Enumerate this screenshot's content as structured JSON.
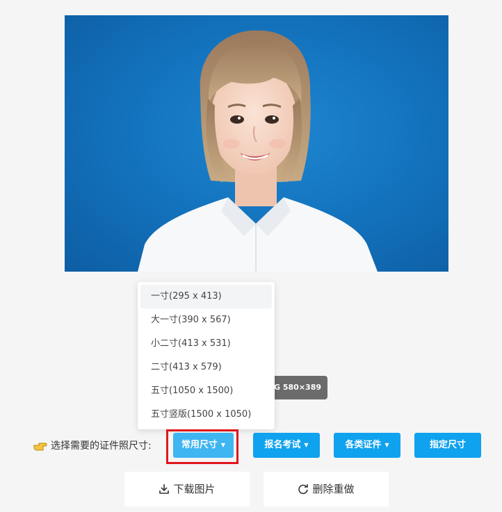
{
  "photo": {
    "alt": "ID photo portrait on blue background",
    "background_color": "#1474bf"
  },
  "image_info": "PG 580×389",
  "dropdown": {
    "items": [
      {
        "label": "一寸(295 x 413)",
        "active": true
      },
      {
        "label": "大一寸(390 x 567)"
      },
      {
        "label": "小二寸(413 x 531)"
      },
      {
        "label": "二寸(413 x 579)"
      },
      {
        "label": "五寸(1050 x 1500)"
      },
      {
        "label": "五寸竖版(1500 x 1050)"
      }
    ]
  },
  "size_row": {
    "label": "选择需要的证件照尺寸:",
    "buttons": {
      "common": "常用尺寸",
      "exam": "报名考试",
      "certs": "各类证件",
      "custom": "指定尺寸"
    }
  },
  "actions": {
    "download": "下载图片",
    "redo": "删除重做"
  },
  "colors": {
    "accent": "#0fa2ee",
    "highlight": "#e0161c"
  }
}
